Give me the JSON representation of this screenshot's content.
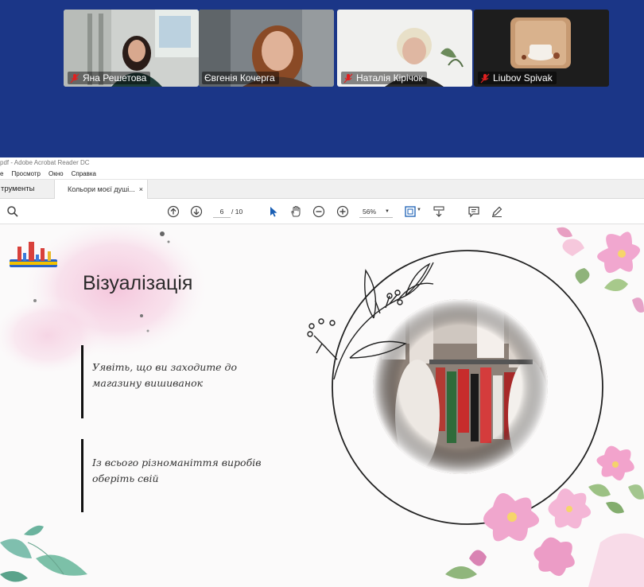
{
  "call": {
    "participants": [
      {
        "name": "Яна Решетова",
        "muted": true,
        "active": false
      },
      {
        "name": "Євгенія Кочерга",
        "muted": false,
        "active": true
      },
      {
        "name": "Наталія Кірічок",
        "muted": true,
        "active": false
      },
      {
        "name": "Liubov Spivak",
        "muted": true,
        "active": false
      }
    ]
  },
  "acrobat": {
    "window_title": "pdf - Adobe Acrobat Reader DC",
    "menu": [
      "е",
      "Просмотр",
      "Окно",
      "Справка"
    ],
    "tabs": {
      "tools": "трументы",
      "document": "Кольори моєї душі...",
      "close": "×"
    },
    "toolbar": {
      "page_current": "6",
      "page_total": "/ 10",
      "zoom": "56%"
    }
  },
  "slide": {
    "title": "Візуалізація",
    "quote1": "Уявіть, що ви заходите до магазину вишиванок",
    "quote2": "Із всього різноманіття виробів оберіть свій"
  },
  "colors": {
    "call_bg": "#1b3687",
    "active_border": "#3fe29a",
    "mic_muted": "#e02020"
  }
}
